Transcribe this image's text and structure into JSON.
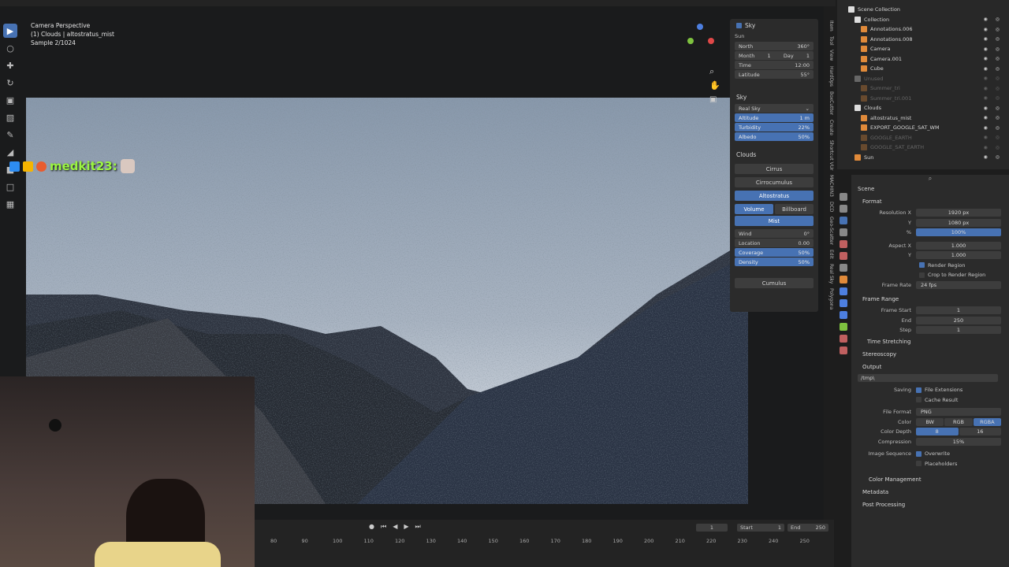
{
  "viewport": {
    "info": [
      "Camera Perspective",
      "(1) Clouds | altostratus_mist",
      "Sample 2/1024"
    ]
  },
  "toolbar_icons": [
    "cursor-icon",
    "select-icon",
    "move-icon",
    "rotate-icon",
    "scale-icon",
    "transform-icon",
    "annotate-icon",
    "measure-icon",
    "add-icon",
    "extra-icon",
    "extra2-icon"
  ],
  "chat": {
    "user": "medkit23:"
  },
  "sky_panel": {
    "sky_title": "Sky",
    "sun_label": "Sun",
    "north": {
      "label": "North",
      "value": "360°"
    },
    "month": {
      "label": "Month",
      "value": "1"
    },
    "day": {
      "label": "Day",
      "value": "1"
    },
    "time": {
      "label": "Time",
      "value": "12:00"
    },
    "latitude": {
      "label": "Latitude",
      "value": "55°"
    },
    "sky2_title": "Sky",
    "sky_type": "Real Sky",
    "altitude": {
      "label": "Altitude",
      "value": "1 m"
    },
    "turbidity": {
      "label": "Turbidity",
      "value": "22%"
    },
    "albedo": {
      "label": "Albedo",
      "value": "50%"
    },
    "clouds_title": "Clouds",
    "cloud_buttons": [
      "Cirrus",
      "Cirrocumulus",
      "Altostratus"
    ],
    "volume_label": "Volume",
    "billboard_label": "Billboard",
    "mist_label": "Mist",
    "wind": {
      "label": "Wind",
      "value": "0°"
    },
    "location": {
      "label": "Location",
      "value": "0.00"
    },
    "coverage": {
      "label": "Coverage",
      "value": "50%"
    },
    "density": {
      "label": "Density",
      "value": "50%"
    },
    "cumulus_label": "Cumulus"
  },
  "side_tabs": [
    "Item",
    "Tool",
    "View",
    "HardOps",
    "BoxCutter",
    "Create",
    "Shortcut VUr",
    "MACHIN3",
    "DCD",
    "Geo-Scatter",
    "Edit",
    "Real Sky",
    "Polygona"
  ],
  "outliner": {
    "root": "Scene Collection",
    "items": [
      {
        "name": "Collection",
        "dim": false
      },
      {
        "name": "Annotations.006",
        "dim": false
      },
      {
        "name": "Annotations.008",
        "dim": false
      },
      {
        "name": "Camera",
        "dim": false
      },
      {
        "name": "Camera.001",
        "dim": false
      },
      {
        "name": "Cube",
        "dim": false
      },
      {
        "name": "Unused",
        "dim": true
      },
      {
        "name": "Summer_tri",
        "dim": true
      },
      {
        "name": "Summer_tri.001",
        "dim": true
      },
      {
        "name": "Clouds",
        "dim": false
      },
      {
        "name": "altostratus_mist",
        "dim": false
      },
      {
        "name": "EXPORT_GOOGLE_SAT_WM",
        "dim": false
      },
      {
        "name": "GOOGLE_EARTH",
        "dim": true
      },
      {
        "name": "GOOGLE_SAT_EARTH",
        "dim": true
      },
      {
        "name": "Sun",
        "dim": false
      }
    ]
  },
  "properties": {
    "scene_label": "Scene",
    "format_label": "Format",
    "resolution_x": {
      "label": "Resolution X",
      "value": "1920 px"
    },
    "resolution_y": {
      "label": "Y",
      "value": "1080 px"
    },
    "resolution_pct": {
      "label": "%",
      "value": "100%"
    },
    "aspect_x": {
      "label": "Aspect X",
      "value": "1.000"
    },
    "aspect_y": {
      "label": "Y",
      "value": "1.000"
    },
    "render_region": "Render Region",
    "crop_region": "Crop to Render Region",
    "frame_rate": {
      "label": "Frame Rate",
      "value": "24 fps"
    },
    "frame_range_label": "Frame Range",
    "frame_start": {
      "label": "Frame Start",
      "value": "1"
    },
    "frame_end": {
      "label": "End",
      "value": "250"
    },
    "frame_step": {
      "label": "Step",
      "value": "1"
    },
    "time_stretching": "Time Stretching",
    "stereoscopy": "Stereoscopy",
    "output_label": "Output",
    "output_path": "/tmp\\",
    "saving_label": "Saving",
    "file_extensions": "File Extensions",
    "cache_result": "Cache Result",
    "file_format": {
      "label": "File Format",
      "value": "PNG"
    },
    "color_label": "Color",
    "color_options": [
      "BW",
      "RGB",
      "RGBA"
    ],
    "color_depth": {
      "label": "Color Depth",
      "options": [
        "8",
        "16"
      ]
    },
    "compression": {
      "label": "Compression",
      "value": "15%"
    },
    "image_sequence": "Image Sequence",
    "overwrite": "Overwrite",
    "placeholders": "Placeholders",
    "color_management": "Color Management",
    "metadata": "Metadata",
    "post_processing": "Post Processing",
    "search_placeholder": ""
  },
  "timeline": {
    "current_frame": "1",
    "start_label": "Start",
    "start_value": "1",
    "end_label": "End",
    "end_value": "250",
    "ruler": [
      "80",
      "90",
      "100",
      "110",
      "120",
      "130",
      "140",
      "150",
      "160",
      "170",
      "180",
      "190",
      "200",
      "210",
      "220",
      "230",
      "240",
      "250"
    ]
  },
  "colors": {
    "accent": "#4772b3",
    "chat": "#9bf542"
  }
}
